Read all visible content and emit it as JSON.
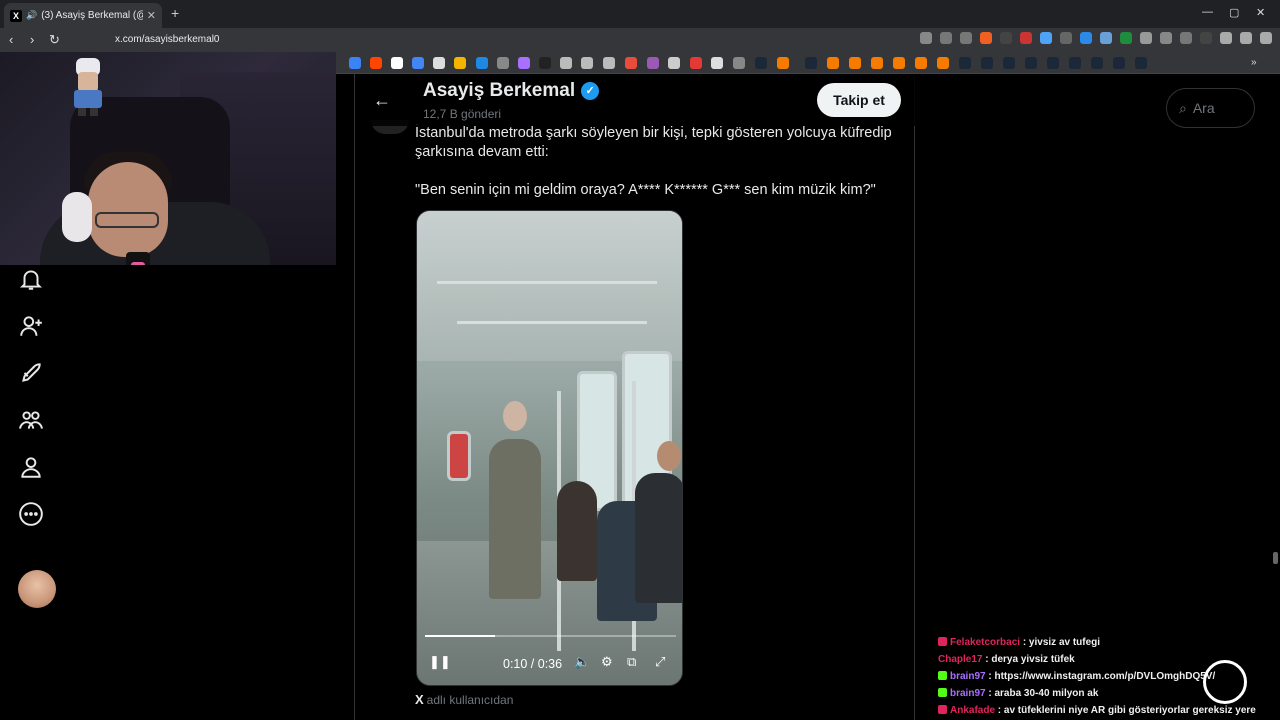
{
  "browser": {
    "tab_title": "(3) Asayiş Berkemal (@asayis",
    "url": "x.com/asayisberkemal0",
    "new_tab": "+",
    "close_tab": "✕",
    "win_min": "—",
    "win_max": "▢",
    "win_close": "✕"
  },
  "profile": {
    "name": "Asayiş Berkemal",
    "posts": "12,7 B gönderi",
    "follow_label": "Takip et"
  },
  "tweet": {
    "line1": "İstanbul'da metroda şarkı söyleyen bir kişi, tepki gösteren yolcuya küfredip şarkısına devam etti:",
    "line2": "\"Ben senin için mi geldim oraya? A**** K****** G*** sen kim müzik kim?\"",
    "from_prefix": "X",
    "from_text": "adlı kullanıcıdan"
  },
  "video": {
    "time": "0:10 / 0:36",
    "progress": 0.28
  },
  "search": {
    "placeholder": "Ara"
  },
  "chat": [
    {
      "user": "Felaketcorbaci",
      "msg": "yivsiz av tufegi",
      "color": "#e0245e",
      "badge": "#e0245e"
    },
    {
      "user": "Chaple17",
      "msg": "derya yivsiz tüfek",
      "color": "#e0245e",
      "badge": ""
    },
    {
      "user": "brain97",
      "msg": "https://www.instagram.com/p/DVLOmghDQ5V/",
      "color": "#a970ff",
      "badge": "#53fc18"
    },
    {
      "user": "brain97",
      "msg": "araba 30-40 milyon ak",
      "color": "#a970ff",
      "badge": "#53fc18"
    },
    {
      "user": "Ankafade",
      "msg": "av tüfeklerini niye AR gibi gösteriyorlar gereksiz yere",
      "color": "#e0245e",
      "badge": "#e0245e"
    }
  ],
  "colors": {
    "accent": "#1d9bf0",
    "background": "#000000",
    "border": "#2f3336"
  }
}
